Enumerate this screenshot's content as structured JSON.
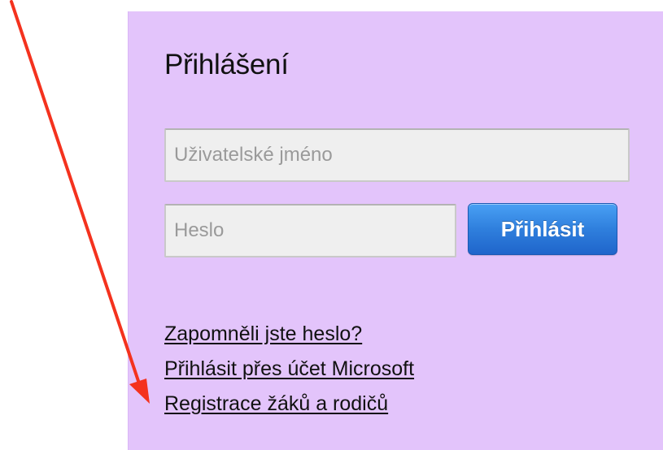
{
  "login": {
    "title": "Přihlášení",
    "username_placeholder": "Uživatelské jméno",
    "password_placeholder": "Heslo",
    "submit_label": "Přihlásit",
    "links": {
      "forgot_password": "Zapomněli jste heslo?",
      "microsoft_login": "Přihlásit přes účet Microsoft",
      "registration": "Registrace žáků a rodičů"
    }
  },
  "colors": {
    "panel_background": "#e3c4fb",
    "button_blue": "#2f7fdd",
    "annotation_arrow": "#f4321e"
  },
  "annotation": {
    "icon": "red-arrow-icon"
  }
}
